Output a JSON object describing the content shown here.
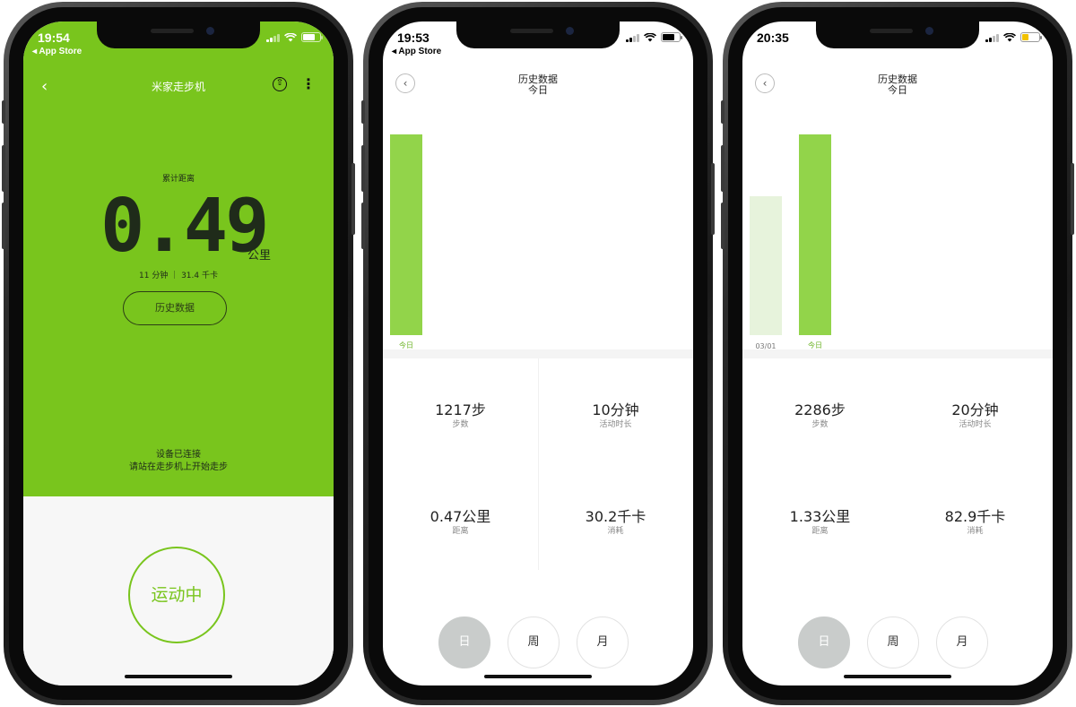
{
  "colors": {
    "brand_green": "#79c51d",
    "bar_today": "#92d44a",
    "bar_past": "#e7f3dc",
    "today_label": "#6bb325",
    "past_label": "#777777",
    "period_active": "#c9cccb"
  },
  "phones": [
    {
      "status": {
        "time": "19:54",
        "back_app": "◂ App Store"
      },
      "nav": {
        "back_icon": "‹",
        "title": "米家走步机",
        "share_icon": "⇧",
        "more_icon": "⋮"
      },
      "metric": {
        "label": "累计距离",
        "value": "0.49",
        "unit": "公里",
        "sub": "11 分钟 ｜ 31.4 千卡"
      },
      "history_button": "历史数据",
      "device_status": [
        "设备已连接",
        "请站在走步机上开始走步"
      ],
      "action_button": "运动中"
    },
    {
      "status": {
        "time": "19:53",
        "back_app": "◂ App Store"
      },
      "header": {
        "back_icon": "‹",
        "title": "历史数据",
        "subtitle": "今日"
      },
      "chart_data": {
        "type": "bar",
        "categories": [
          "今日"
        ],
        "values": [
          1217
        ],
        "highlight": "今日"
      },
      "stats": [
        {
          "value": "1217步",
          "label": "步数"
        },
        {
          "value": "10分钟",
          "label": "活动时长"
        },
        {
          "value": "0.47公里",
          "label": "距离"
        },
        {
          "value": "30.2千卡",
          "label": "消耗"
        }
      ],
      "periods": [
        "日",
        "周",
        "月"
      ],
      "active_period": "日"
    },
    {
      "status": {
        "time": "20:35",
        "back_app": ""
      },
      "header": {
        "back_icon": "‹",
        "title": "历史数据",
        "subtitle": "今日"
      },
      "chart_data": {
        "type": "bar",
        "categories": [
          "03/01",
          "今日"
        ],
        "values": [
          1580,
          2286
        ],
        "highlight": "今日"
      },
      "stats": [
        {
          "value": "2286步",
          "label": "步数"
        },
        {
          "value": "20分钟",
          "label": "活动时长"
        },
        {
          "value": "1.33公里",
          "label": "距离"
        },
        {
          "value": "82.9千卡",
          "label": "消耗"
        }
      ],
      "periods": [
        "日",
        "周",
        "月"
      ],
      "active_period": "日"
    }
  ]
}
